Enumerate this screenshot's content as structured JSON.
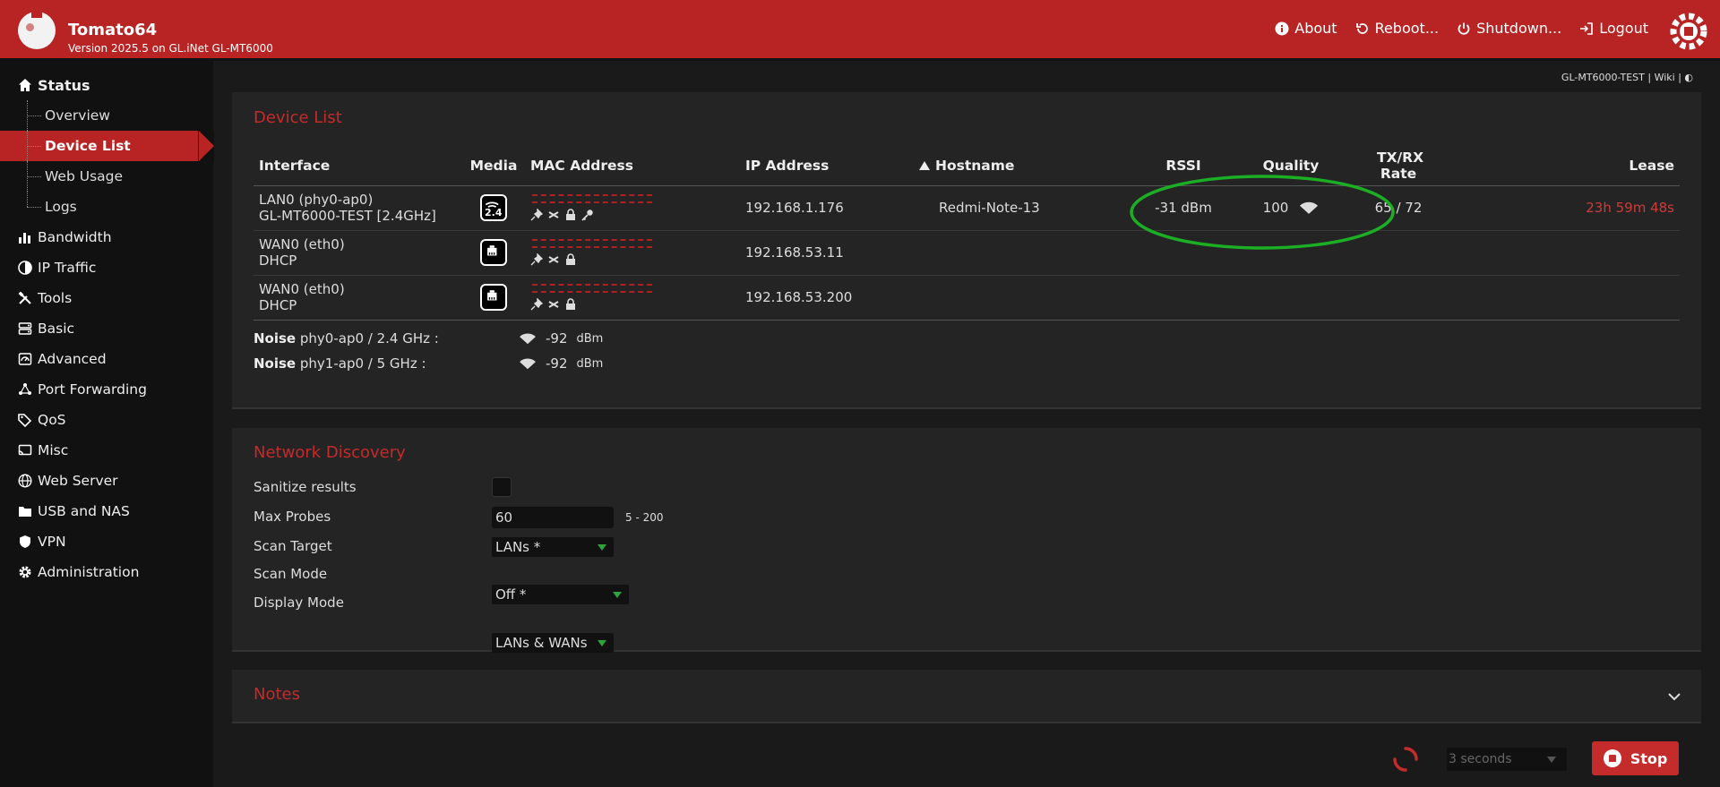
{
  "header": {
    "title": "Tomato64",
    "version": "Version 2025.5 on GL.iNet GL-MT6000",
    "nav": [
      "About",
      "Reboot...",
      "Shutdown...",
      "Logout"
    ]
  },
  "sidebar": {
    "status": "Status",
    "status_items": [
      "Overview",
      "Device List",
      "Web Usage",
      "Logs"
    ],
    "items": [
      "Bandwidth",
      "IP Traffic",
      "Tools",
      "Basic",
      "Advanced",
      "Port Forwarding",
      "QoS",
      "Misc",
      "Web Server",
      "USB and NAS",
      "VPN",
      "Administration"
    ]
  },
  "top_links": "GL-MT6000-TEST | Wiki | ◐",
  "device_list": {
    "title": "Device List",
    "columns": [
      "Interface",
      "Media",
      "MAC Address",
      "IP Address",
      "Hostname",
      "RSSI",
      "Quality",
      "TX/RX Rate",
      "Lease"
    ],
    "rows": [
      {
        "iface": "LAN0 (phy0-ap0)",
        "iface2": "GL-MT6000-TEST [2.4GHz]",
        "media": "2.4",
        "ip": "192.168.1.176",
        "hostname": "Redmi-Note-13",
        "rssi": "-31 dBm",
        "quality": "100",
        "rate": "65 / 72",
        "lease": "23h 59m 48s"
      },
      {
        "iface": "WAN0 (eth0)",
        "iface2": "DHCP",
        "media": "",
        "ip": "192.168.53.11",
        "hostname": "",
        "rssi": "",
        "quality": "",
        "rate": "",
        "lease": ""
      },
      {
        "iface": "WAN0 (eth0)",
        "iface2": "DHCP",
        "media": "",
        "ip": "192.168.53.200",
        "hostname": "",
        "rssi": "",
        "quality": "",
        "rate": "",
        "lease": ""
      }
    ],
    "noise": [
      {
        "label": "Noise",
        "iface": "phy0-ap0 / 2.4 GHz :",
        "value": "-92",
        "unit": "dBm"
      },
      {
        "label": "Noise",
        "iface": "phy1-ap0 / 5 GHz :",
        "value": "-92",
        "unit": "dBm"
      }
    ]
  },
  "discovery": {
    "title": "Network Discovery",
    "sanitize_label": "Sanitize results",
    "max_probes_label": "Max Probes",
    "max_probes_value": "60",
    "max_probes_hint": "5 - 200",
    "scan_target_label": "Scan Target",
    "scan_target_value": "LANs *",
    "scan_mode_label": "Scan Mode",
    "scan_mode_value": "Off *",
    "display_mode_label": "Display Mode",
    "display_mode_value": "LANs & WANs"
  },
  "notes": {
    "title": "Notes"
  },
  "footer": {
    "refresh_value": "3 seconds",
    "stop_label": "Stop"
  },
  "colors": {
    "header": "#b82424",
    "accent_red": "#c42b2b",
    "annotation_green": "#1cae24"
  }
}
